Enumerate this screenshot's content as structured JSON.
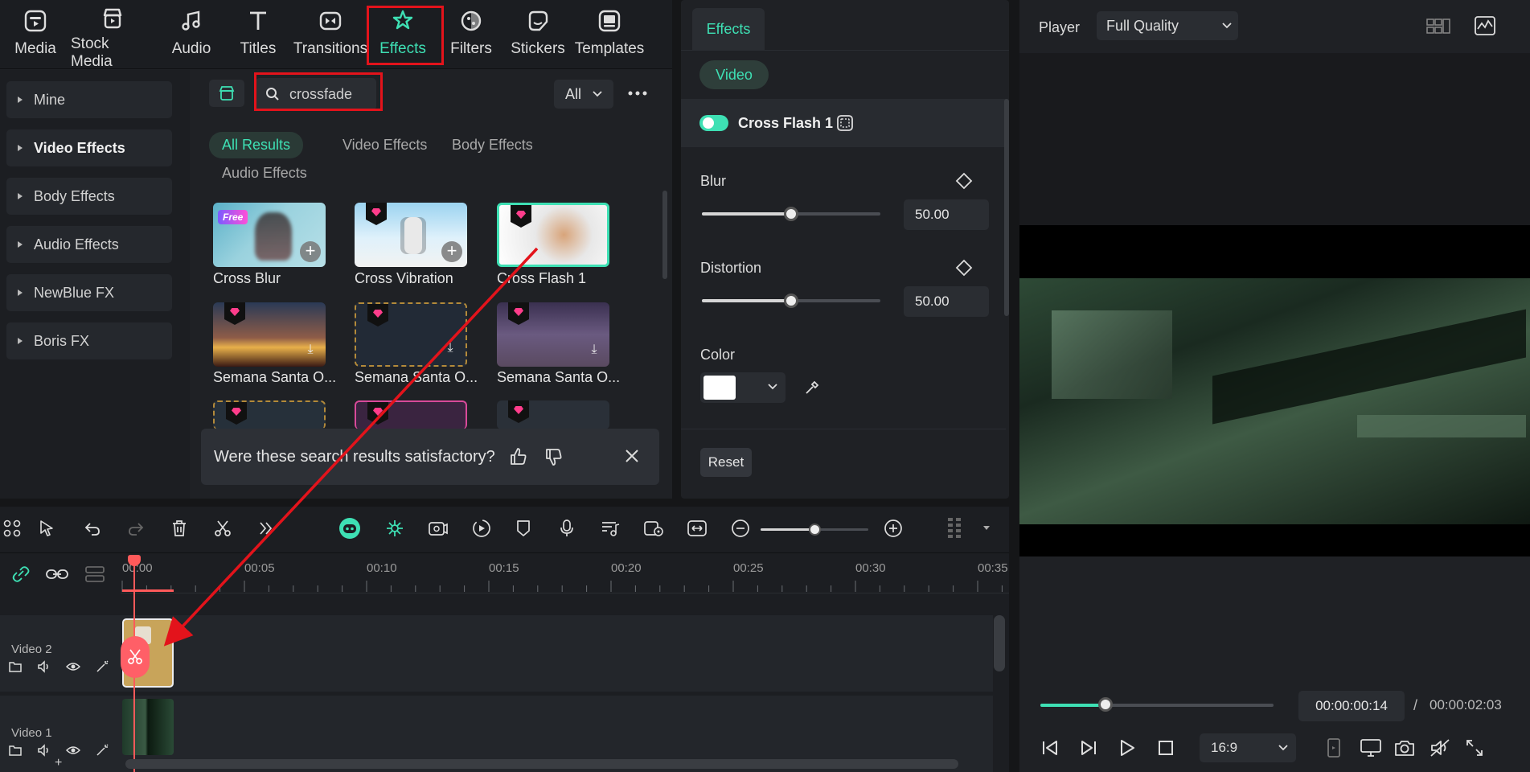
{
  "nav": {
    "items": [
      {
        "label": "Media",
        "icon": "media-icon"
      },
      {
        "label": "Stock Media",
        "icon": "stock-media-icon"
      },
      {
        "label": "Audio",
        "icon": "music-note-icon"
      },
      {
        "label": "Titles",
        "icon": "titles-t-icon"
      },
      {
        "label": "Transitions",
        "icon": "transitions-icon"
      },
      {
        "label": "Effects",
        "icon": "effects-star-icon"
      },
      {
        "label": "Filters",
        "icon": "filters-icon"
      },
      {
        "label": "Stickers",
        "icon": "stickers-icon"
      },
      {
        "label": "Templates",
        "icon": "templates-icon"
      }
    ],
    "active": "Effects"
  },
  "sidebar": {
    "items": [
      {
        "label": "Mine"
      },
      {
        "label": "Video Effects"
      },
      {
        "label": "Body Effects"
      },
      {
        "label": "Audio Effects"
      },
      {
        "label": "NewBlue FX"
      },
      {
        "label": "Boris FX"
      }
    ]
  },
  "search": {
    "value": "crossfade",
    "filter_value": "All"
  },
  "result_tabs": [
    "All Results",
    "Video Effects",
    "Body Effects",
    "Audio Effects"
  ],
  "results": [
    {
      "label": "Cross Blur",
      "badge": "Free"
    },
    {
      "label": "Cross Vibration"
    },
    {
      "label": "Cross Flash 1"
    },
    {
      "label": "Semana Santa O..."
    },
    {
      "label": "Semana Santa O..."
    },
    {
      "label": "Semana Santa O..."
    }
  ],
  "feedback": {
    "question": "Were these search results satisfactory?"
  },
  "props": {
    "tab": "Effects",
    "subtab": "Video",
    "effect_name": "Cross Flash 1",
    "effect_enabled": true,
    "blur": {
      "label": "Blur",
      "value": "50.00",
      "level": 0.5
    },
    "distortion": {
      "label": "Distortion",
      "value": "50.00",
      "level": 0.5
    },
    "color": {
      "label": "Color",
      "value": "#ffffff"
    },
    "reset_label": "Reset"
  },
  "player": {
    "label": "Player",
    "quality": "Full Quality",
    "current_time": "00:00:00:14",
    "separator": "/",
    "total_time": "00:00:02:03",
    "aspect": "16:9",
    "progress": 0.28
  },
  "timeline": {
    "ruler": [
      "00:00",
      "00:05",
      "00:10",
      "00:15",
      "00:20",
      "00:25",
      "00:30",
      "00:35"
    ],
    "tracks": [
      {
        "label": "Video 2"
      },
      {
        "label": "Video 1"
      }
    ],
    "zoom_level": 0.5
  },
  "colors": {
    "accent": "#3ee0b4",
    "annotation_red": "#e3131b",
    "playhead": "#ff5a5a"
  }
}
